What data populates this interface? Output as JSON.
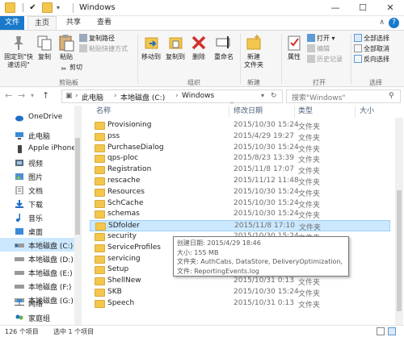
{
  "window": {
    "title": "Windows"
  },
  "tabs": {
    "file": "文件",
    "home": "主页",
    "share": "共享",
    "view": "查看"
  },
  "ribbon": {
    "clipboard": {
      "pin": "固定到\"快\n速访问\"",
      "copy": "复制",
      "paste": "粘贴",
      "copy_path": "复制路径",
      "paste_shortcut": "粘贴快捷方式",
      "cut": "剪切",
      "group_label": "剪贴板"
    },
    "organize": {
      "move_to": "移动到",
      "copy_to": "复制到",
      "delete": "删除",
      "rename": "重命名",
      "group_label": "组织"
    },
    "new": {
      "new_folder": "新建\n文件夹",
      "group_label": "新建"
    },
    "open": {
      "properties": "属性",
      "open": "打开",
      "edit": "编辑",
      "history": "历史记录",
      "group_label": "打开"
    },
    "select": {
      "select_all": "全部选择",
      "select_none": "全部取消",
      "invert": "反向选择",
      "group_label": "选择"
    }
  },
  "address": {
    "crumbs": [
      "此电脑",
      "本地磁盘 (C:)",
      "Windows"
    ],
    "search_placeholder": "搜索\"Windows\""
  },
  "nav": [
    {
      "label": "OneDrive",
      "icon": "cloud-icon"
    },
    {
      "label": "此电脑",
      "icon": "computer-icon"
    },
    {
      "label": "Apple iPhone",
      "icon": "phone-icon"
    },
    {
      "label": "视频",
      "icon": "video-icon"
    },
    {
      "label": "图片",
      "icon": "picture-icon"
    },
    {
      "label": "文档",
      "icon": "document-icon"
    },
    {
      "label": "下载",
      "icon": "download-icon"
    },
    {
      "label": "音乐",
      "icon": "music-icon"
    },
    {
      "label": "桌面",
      "icon": "desktop-icon"
    },
    {
      "label": "本地磁盘 (C:)",
      "icon": "drive-icon"
    },
    {
      "label": "本地磁盘 (D:)",
      "icon": "drive-icon"
    },
    {
      "label": "本地磁盘 (E:)",
      "icon": "drive-icon"
    },
    {
      "label": "本地磁盘 (F:)",
      "icon": "drive-icon"
    },
    {
      "label": "本地磁盘 (G:)",
      "icon": "drive-icon"
    },
    {
      "label": "网络",
      "icon": "network-icon"
    },
    {
      "label": "家庭组",
      "icon": "homegroup-icon"
    }
  ],
  "columns": {
    "name": "名称",
    "date": "修改日期",
    "type": "类型",
    "size": "大小"
  },
  "files": [
    {
      "name": "Provisioning",
      "date": "2015/10/30 15:24",
      "type": "文件夹"
    },
    {
      "name": "pss",
      "date": "2015/4/29 19:27",
      "type": "文件夹"
    },
    {
      "name": "PurchaseDialog",
      "date": "2015/10/30 15:24",
      "type": "文件夹"
    },
    {
      "name": "qps-ploc",
      "date": "2015/8/23 13:39",
      "type": "文件夹"
    },
    {
      "name": "Registration",
      "date": "2015/11/8 17:07",
      "type": "文件夹"
    },
    {
      "name": "rescache",
      "date": "2015/11/12 11:48",
      "type": "文件夹"
    },
    {
      "name": "Resources",
      "date": "2015/10/30 15:24",
      "type": "文件夹"
    },
    {
      "name": "SchCache",
      "date": "2015/10/30 15:24",
      "type": "文件夹"
    },
    {
      "name": "schemas",
      "date": "2015/10/30 15:24",
      "type": "文件夹"
    },
    {
      "name": "SDfolder",
      "date": "2015/11/8 17:10",
      "type": "文件夹"
    },
    {
      "name": "security",
      "date": "2015/10/30 15:24",
      "type": "文件夹"
    },
    {
      "name": "ServiceProfiles",
      "date": "",
      "type": ""
    },
    {
      "name": "servicing",
      "date": "",
      "type": ""
    },
    {
      "name": "Setup",
      "date": "",
      "type": ""
    },
    {
      "name": "ShellNew",
      "date": "2015/10/31 0:13",
      "type": "文件夹"
    },
    {
      "name": "SKB",
      "date": "2015/10/30 15:24",
      "type": "文件夹"
    },
    {
      "name": "Speech",
      "date": "2015/10/31 0:13",
      "type": "文件夹"
    }
  ],
  "tooltip": {
    "created": "创建日期: 2015/4/29 18:46",
    "size": "大小: 155 MB",
    "folders": "文件夹: AuthCabs, DataStore, DeliveryOptimization, Download, ...",
    "files": "文件: ReportingEvents.log"
  },
  "status": {
    "count": "126 个项目",
    "selected": "选中 1 个项目"
  }
}
